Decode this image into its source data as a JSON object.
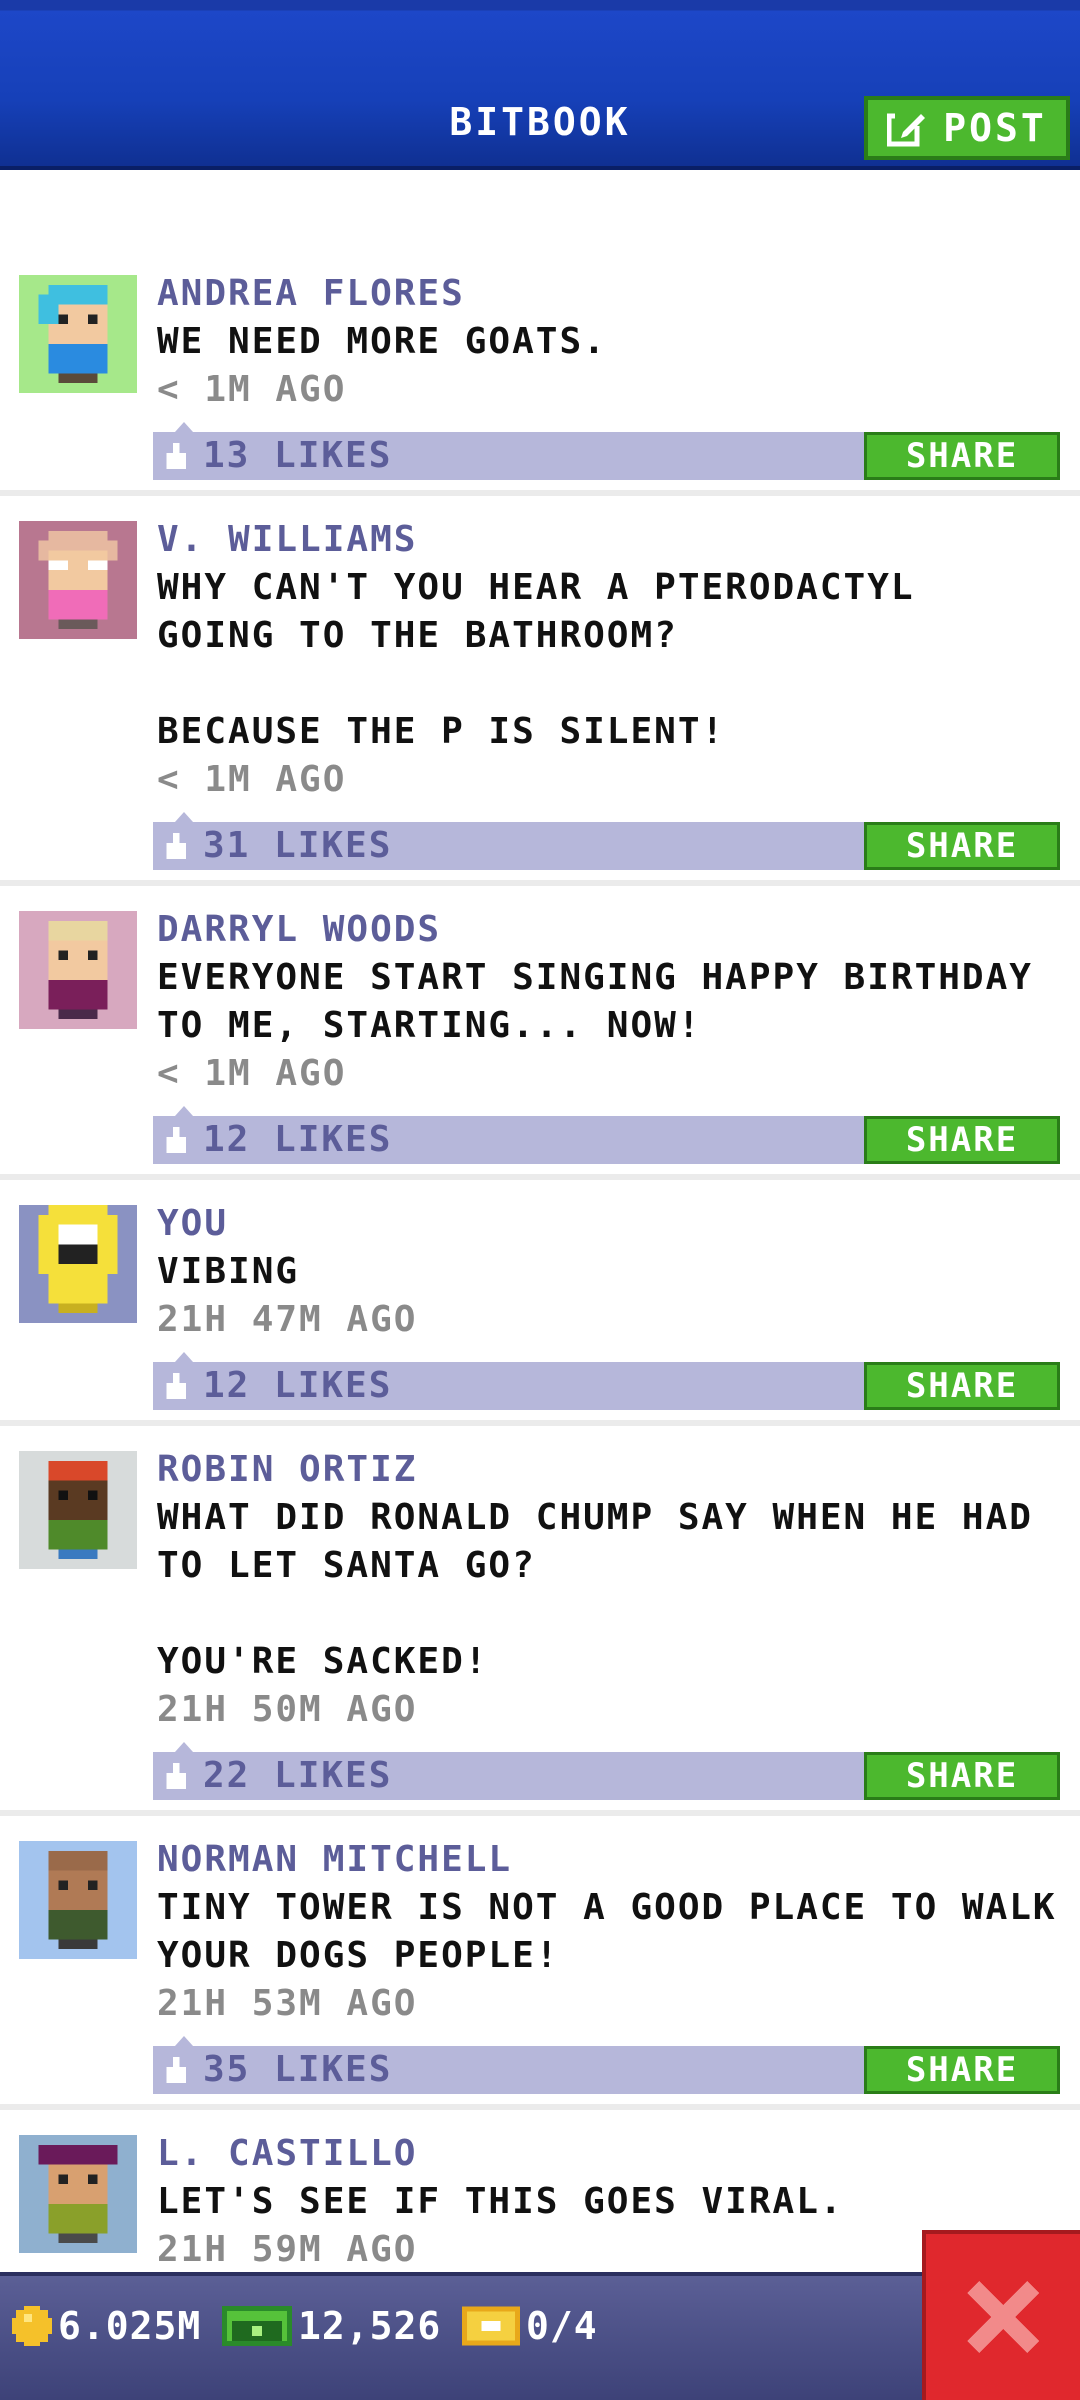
{
  "header": {
    "title": "BITBOOK",
    "post_label": "POST"
  },
  "posts": [
    {
      "name": "ANDREA FLORES",
      "message": "WE NEED MORE GOATS.",
      "time": "< 1M AGO",
      "likes": "13 LIKES",
      "share": "SHARE",
      "avatar_bg": "#a6e88a"
    },
    {
      "name": "V. WILLIAMS",
      "message": "WHY CAN'T YOU HEAR A PTERODACTYL\nGOING TO THE BATHROOM?\n\nBECAUSE THE P IS SILENT!",
      "time": "< 1M AGO",
      "likes": "31 LIKES",
      "share": "SHARE",
      "avatar_bg": "#b87790"
    },
    {
      "name": "DARRYL WOODS",
      "message": "EVERYONE START SINGING HAPPY BIRTHDAY\nTO ME, STARTING... NOW!",
      "time": "< 1M AGO",
      "likes": "12 LIKES",
      "share": "SHARE",
      "avatar_bg": "#d7a8bf"
    },
    {
      "name": "YOU",
      "message": "VIBING",
      "time": "21H 47M AGO",
      "likes": "12 LIKES",
      "share": "SHARE",
      "avatar_bg": "#8a92c2"
    },
    {
      "name": "ROBIN ORTIZ",
      "message": "WHAT DID RONALD CHUMP SAY WHEN HE HAD\nTO LET SANTA GO?\n\nYOU'RE SACKED!",
      "time": "21H 50M AGO",
      "likes": "22 LIKES",
      "share": "SHARE",
      "avatar_bg": "#d7dbdb"
    },
    {
      "name": "NORMAN MITCHELL",
      "message": "TINY TOWER IS NOT A GOOD PLACE TO WALK\nYOUR DOGS PEOPLE!",
      "time": "21H 53M AGO",
      "likes": "35 LIKES",
      "share": "SHARE",
      "avatar_bg": "#a3c4ee"
    },
    {
      "name": "L. CASTILLO",
      "message": "LET'S SEE IF THIS GOES VIRAL.",
      "time": "21H 59M AGO",
      "likes": "",
      "share": "",
      "avatar_bg": "#8fb0cf"
    }
  ],
  "bottom": {
    "coins": "6.025M",
    "bux": "12,526",
    "tickets": "0/4"
  },
  "colors": {
    "header_blue": "#1640b8",
    "accent_green": "#4cb82e",
    "name_purple": "#5c5d99",
    "like_bar": "#b6b7da",
    "close_red": "#e0282d"
  },
  "icons": [
    "edit-icon",
    "like-icon",
    "coin-icon",
    "bux-icon",
    "ticket-icon",
    "close-icon"
  ]
}
